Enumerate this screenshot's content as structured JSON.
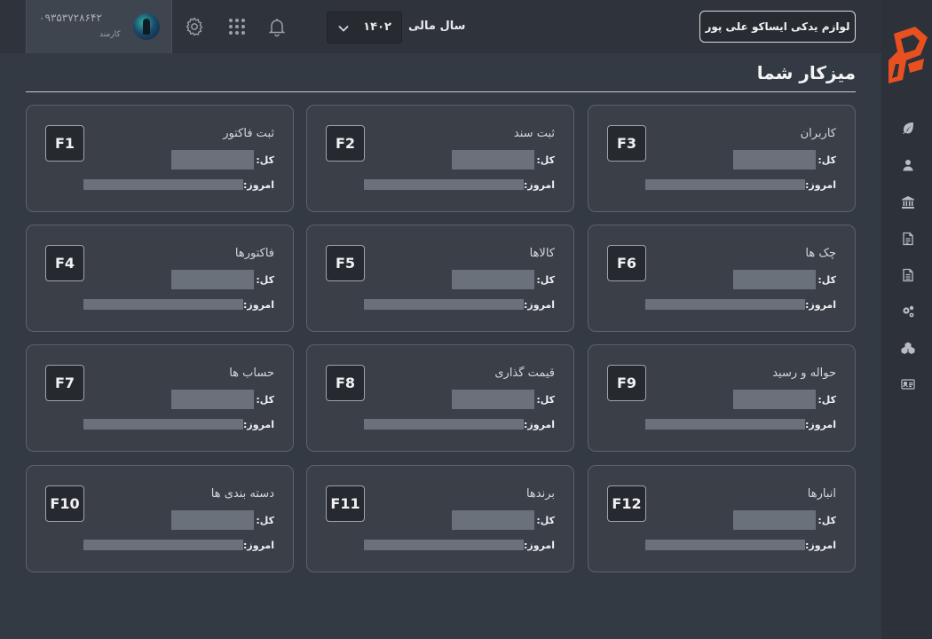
{
  "header": {
    "user_phone": "۰۹۳۵۳۷۲۸۶۴۲",
    "user_role": "کارمند",
    "fiscal_year_label": "سال مالی",
    "fiscal_year_value": "۱۴۰۲",
    "company_name": "لوازم یدکی ایساکو علی پور"
  },
  "page": {
    "title": "میزکار شما"
  },
  "labels": {
    "total": "کل:",
    "today": "امروز:"
  },
  "cards": [
    {
      "title": "کاربران",
      "key": "F3"
    },
    {
      "title": "ثبت سند",
      "key": "F2"
    },
    {
      "title": "ثبت فاکتور",
      "key": "F1"
    },
    {
      "title": "چک ها",
      "key": "F6"
    },
    {
      "title": "کالاها",
      "key": "F5"
    },
    {
      "title": "فاکتورها",
      "key": "F4"
    },
    {
      "title": "حواله و رسید",
      "key": "F9"
    },
    {
      "title": "قیمت گذاری",
      "key": "F8"
    },
    {
      "title": "حساب ها",
      "key": "F7"
    },
    {
      "title": "انبارها",
      "key": "F12"
    },
    {
      "title": "برندها",
      "key": "F11"
    },
    {
      "title": "دسته بندی ها",
      "key": "F10"
    }
  ],
  "sidebar_icons": [
    "leaf-icon",
    "user-icon",
    "bank-icon",
    "document-icon",
    "document-alt-icon",
    "gears-icon",
    "boxes-icon",
    "id-card-icon"
  ],
  "colors": {
    "background": "#343a43",
    "card": "#3a3f48",
    "sidebar": "#2d3139",
    "logo_accent": "#e8501f"
  }
}
